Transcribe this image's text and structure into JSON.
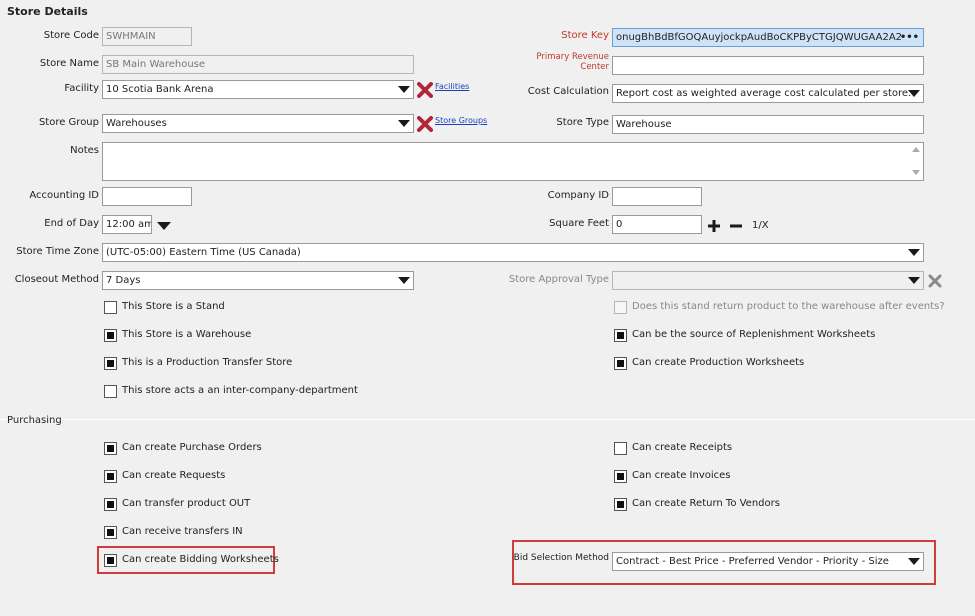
{
  "section_title": "Store Details",
  "store_code": {
    "label": "Store Code",
    "value": "SWHMAIN"
  },
  "store_name": {
    "label": "Store Name",
    "value": "SB Main Warehouse"
  },
  "facility": {
    "label": "Facility",
    "value": "10 Scotia Bank Arena",
    "link": "Facilities"
  },
  "store_group": {
    "label": "Store Group",
    "value": "Warehouses",
    "link": "Store Groups"
  },
  "notes": {
    "label": "Notes",
    "value": ""
  },
  "store_key": {
    "label": "Store Key",
    "value": "onugBhBdBfGOQAuyjockpAudBoCKPByCTGJQWUGAA2A2",
    "dots": "•••"
  },
  "primary_revenue_center": {
    "label_line1": "Primary Revenue",
    "label_line2": "Center",
    "value": ""
  },
  "cost_calculation": {
    "label": "Cost Calculation",
    "value": "Report cost as weighted average cost calculated per store."
  },
  "store_type": {
    "label": "Store Type",
    "value": "Warehouse"
  },
  "accounting_id": {
    "label": "Accounting ID",
    "value": ""
  },
  "company_id": {
    "label": "Company ID",
    "value": ""
  },
  "end_of_day": {
    "label": "End of Day",
    "value": "12:00 am"
  },
  "square_feet": {
    "label": "Square Feet",
    "value": "0",
    "reciprocal": "1/X"
  },
  "store_time_zone": {
    "label": "Store Time Zone",
    "value": "(UTC-05:00) Eastern Time (US  Canada)"
  },
  "closeout_method": {
    "label": "Closeout Method",
    "value": "7  Days"
  },
  "store_approval_type": {
    "label": "Store Approval Type",
    "value": ""
  },
  "checkboxes_left": [
    {
      "label": "This Store is a Stand",
      "checked": false
    },
    {
      "label": "This Store is a Warehouse",
      "checked": true
    },
    {
      "label": "This is a Production Transfer Store",
      "checked": true
    },
    {
      "label": "This store acts a an inter-company-department",
      "checked": false
    }
  ],
  "checkboxes_right": [
    {
      "label": "Does this stand return product to the warehouse after events?",
      "checked": false,
      "disabled": true
    },
    {
      "label": "Can be the source of Replenishment Worksheets",
      "checked": true
    },
    {
      "label": "Can create Production Worksheets",
      "checked": true
    }
  ],
  "purchasing_title": "Purchasing",
  "purchasing_left": [
    {
      "label": "Can create Purchase Orders",
      "checked": true
    },
    {
      "label": "Can create Requests",
      "checked": true
    },
    {
      "label": "Can transfer product OUT",
      "checked": true
    },
    {
      "label": "Can receive transfers IN",
      "checked": true
    },
    {
      "label": "Can create Bidding Worksheets",
      "checked": true
    }
  ],
  "purchasing_right": [
    {
      "label": "Can create Receipts",
      "checked": false
    },
    {
      "label": "Can create Invoices",
      "checked": true
    },
    {
      "label": "Can create Return To Vendors",
      "checked": true
    }
  ],
  "bid_selection_method": {
    "label": "Bid Selection Method",
    "value": "Contract - Best Price - Preferred Vendor - Priority - Size"
  },
  "colors": {
    "accent_red": "#c0392b",
    "highlight_box": "#d23b3b",
    "delete_x": "#b0273a",
    "link": "#1a3fbf"
  }
}
